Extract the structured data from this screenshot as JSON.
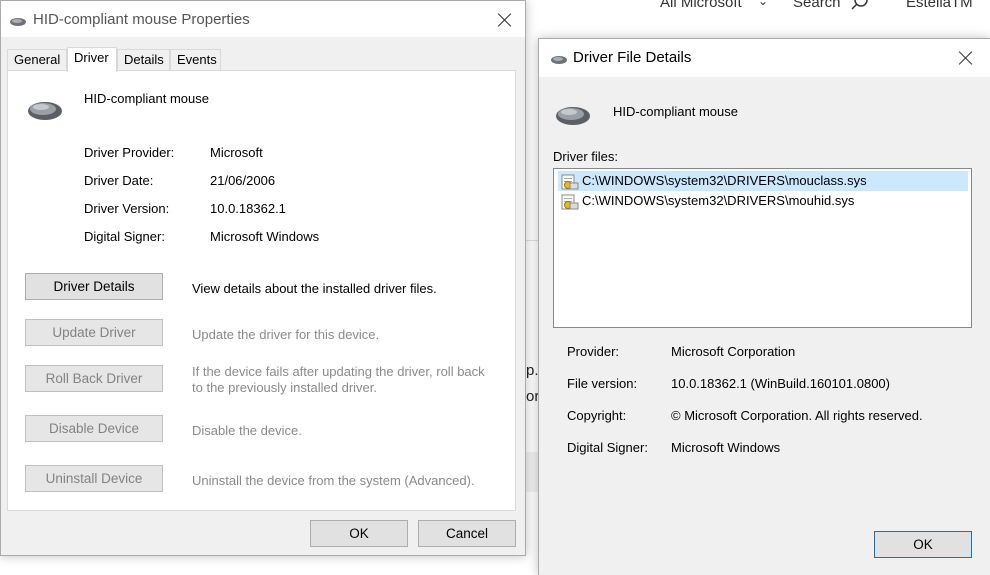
{
  "background": {
    "nav_all_microsoft": "All Microsoft",
    "nav_search": "Search",
    "nav_user": "EstellaTM",
    "side_text_1": "p.",
    "side_text_2": "or"
  },
  "properties_dialog": {
    "title": "HID-compliant mouse Properties",
    "tabs": [
      "General",
      "Driver",
      "Details",
      "Events"
    ],
    "device_name": "HID-compliant mouse",
    "fields": {
      "provider_label": "Driver Provider:",
      "provider_value": "Microsoft",
      "date_label": "Driver Date:",
      "date_value": "21/06/2006",
      "version_label": "Driver Version:",
      "version_value": "10.0.18362.1",
      "signer_label": "Digital Signer:",
      "signer_value": "Microsoft Windows"
    },
    "actions": {
      "driver_details_label": "Driver Details",
      "driver_details_desc": "View details about the installed driver files.",
      "update_driver_label": "Update Driver",
      "update_driver_desc": "Update the driver for this device.",
      "roll_back_label": "Roll Back Driver",
      "roll_back_desc_1": "If the device fails after updating the driver, roll back",
      "roll_back_desc_2": "to the previously installed driver.",
      "disable_label": "Disable Device",
      "disable_desc": "Disable the device.",
      "uninstall_label": "Uninstall Device",
      "uninstall_desc": "Uninstall the device from the system (Advanced)."
    },
    "ok_label": "OK",
    "cancel_label": "Cancel"
  },
  "details_dialog": {
    "title": "Driver File Details",
    "device_name": "HID-compliant mouse",
    "files_label": "Driver files:",
    "files": [
      "C:\\WINDOWS\\system32\\DRIVERS\\mouclass.sys",
      "C:\\WINDOWS\\system32\\DRIVERS\\mouhid.sys"
    ],
    "selected_index": 0,
    "info": {
      "provider_label": "Provider:",
      "provider_value": "Microsoft Corporation",
      "version_label": "File version:",
      "version_value": "10.0.18362.1 (WinBuild.160101.0800)",
      "copyright_label": "Copyright:",
      "copyright_value": "© Microsoft Corporation. All rights reserved.",
      "signer_label": "Digital Signer:",
      "signer_value": "Microsoft Windows"
    },
    "ok_label": "OK"
  },
  "colors": {
    "dialog_bg": "#f0f0f0",
    "selection": "#cce8ff",
    "focus_border": "#0078d7",
    "disabled_text": "#838383"
  },
  "icons": {
    "device": "mouse-icon",
    "file": "system-file-icon",
    "close": "close-icon"
  }
}
